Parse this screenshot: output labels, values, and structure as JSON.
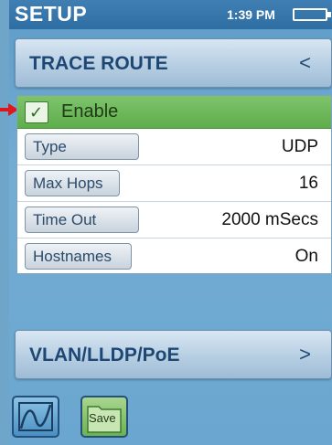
{
  "statusbar": {
    "title": "SETUP",
    "time": "1:39 PM"
  },
  "trace_route": {
    "label": "TRACE ROUTE",
    "chevron": "<"
  },
  "enable": {
    "checked": true,
    "check_glyph": "✓",
    "label": "Enable"
  },
  "rows": [
    {
      "label": "Type",
      "value": "UDP"
    },
    {
      "label": "Max Hops",
      "value": "16"
    },
    {
      "label": "Time Out",
      "value": "2000 mSecs"
    },
    {
      "label": "Hostnames",
      "value": "On"
    }
  ],
  "vlan": {
    "label": "VLAN/LLDP/PoE",
    "chevron": ">"
  },
  "bottom": {
    "graph_icon": "graph-icon",
    "save_label": "Save"
  },
  "colors": {
    "accent_green": "#6cb252",
    "header_text": "#1e4873",
    "background": "#6fa5c9",
    "arrow": "#e0161b"
  }
}
